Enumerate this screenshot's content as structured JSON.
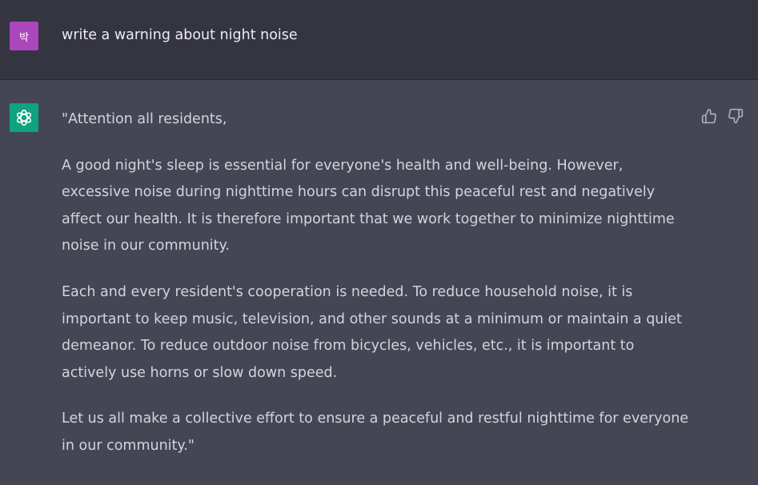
{
  "user": {
    "avatar_initial": "박",
    "avatar_color": "#ab47bc",
    "prompt": "write a warning about night noise"
  },
  "assistant": {
    "avatar_icon": "openai-logo-icon",
    "avatar_color": "#10a37f",
    "paragraphs": [
      "\"Attention all residents,",
      "A good night's sleep is essential for everyone's health and well-being. However,\nexcessive noise during nighttime hours can disrupt this peaceful rest and negatively\naffect our health. It is therefore important that we work together to minimize nighttime\nnoise in our community.",
      "Each and every resident's cooperation is needed. To reduce household noise, it is\nimportant to keep music, television, and other sounds at a minimum or maintain a quiet\ndemeanor. To reduce outdoor noise from bicycles, vehicles, etc., it is important to\nactively use horns or slow down speed.",
      "Let us all make a collective effort to ensure a peaceful and restful nighttime for everyone\nin our community.\""
    ],
    "feedback": {
      "up_icon": "thumbs-up-icon",
      "down_icon": "thumbs-down-icon"
    }
  },
  "colors": {
    "user_bg": "#343541",
    "assistant_bg": "#444654",
    "text": "#d1d5db"
  }
}
